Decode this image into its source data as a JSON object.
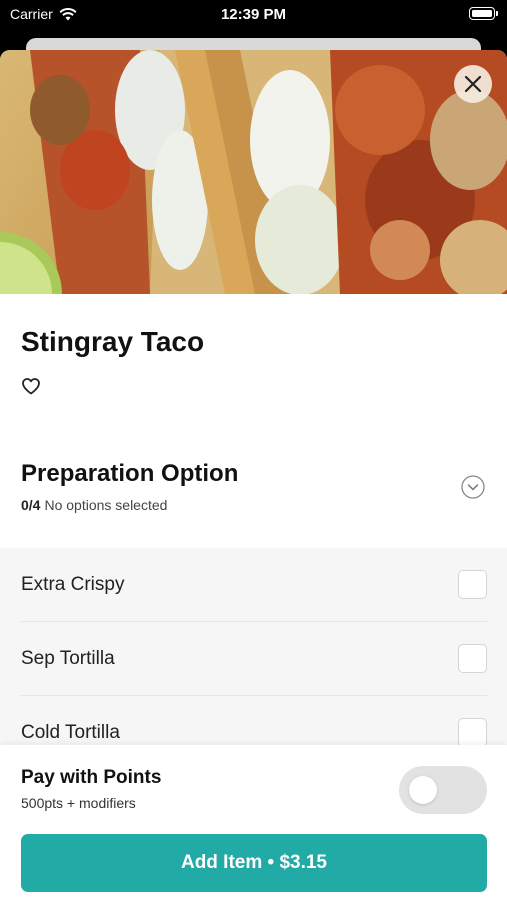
{
  "status_bar": {
    "carrier": "Carrier",
    "time": "12:39 PM"
  },
  "item": {
    "title": "Stingray Taco",
    "favorite_icon": "heart-outline-icon"
  },
  "preparation": {
    "title": "Preparation Option",
    "selected_count": "0/4",
    "selected_text": "No options selected",
    "options": [
      {
        "label": "Extra Crispy"
      },
      {
        "label": "Sep Tortilla"
      },
      {
        "label": "Cold Tortilla"
      }
    ]
  },
  "footer": {
    "pay_title": "Pay with Points",
    "pay_subtitle": "500pts + modifiers",
    "add_button_label": "Add Item • $3.15"
  },
  "colors": {
    "accent": "#22aaa7"
  }
}
